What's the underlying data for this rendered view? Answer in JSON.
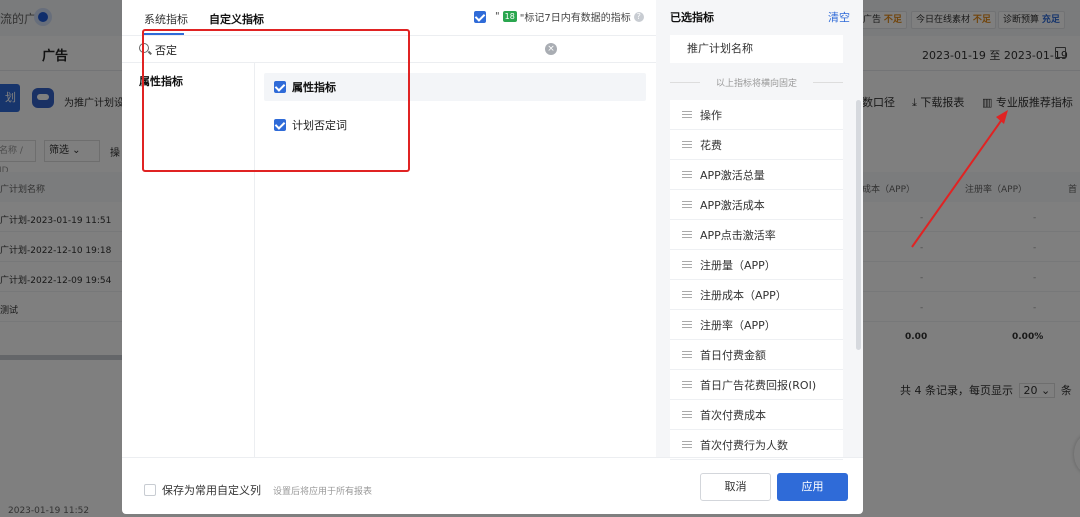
{
  "background": {
    "brand": "流的广告",
    "tab": "广告",
    "robot_text": "为推广计划设置",
    "blue_btn": "划",
    "name_placeholder": "名称 / ID",
    "filter_label": "筛选",
    "filter_tail": "操",
    "col_name": "广计划名称",
    "col_cost": "成本（APP）",
    "col_reg_rate": "注册率（APP）",
    "col_first": "首",
    "rows": [
      "广计划-2023-01-19 11:51",
      "广计划-2022-12-10 19:18",
      "广计划-2022-12-09 19:54",
      "测试"
    ],
    "dash": "-",
    "total_cost": "0.00",
    "total_rate": "0.00%",
    "badges": [
      {
        "label": "广告",
        "status": "不足",
        "kind": "warn"
      },
      {
        "label": "今日在线素材",
        "status": "不足",
        "kind": "warn"
      },
      {
        "label": "诊断预算",
        "status": "充足",
        "kind": "good"
      }
    ],
    "date_range": "2023-01-19 至 2023-01-19",
    "links": [
      "数口径",
      "下载报表",
      "专业版推荐指标"
    ],
    "pager_text": "共 4 条记录，每页显示",
    "page_size": "20",
    "pager_unit": "条",
    "footer_ts": "2023-01-19 11:52"
  },
  "modal": {
    "tabs": [
      "系统指标",
      "自定义指标"
    ],
    "mark7_label_prefix": "\"",
    "mark7_chip": "18",
    "mark7_label": "\"标记7日内有数据的指标",
    "search_value": "否定",
    "left_category": "属性指标",
    "group_label": "属性指标",
    "item_label": "计划否定词"
  },
  "selected": {
    "title": "已选指标",
    "clear": "清空",
    "fixed_item": "推广计划名称",
    "fixed_note": "以上指标将横向固定",
    "items": [
      "操作",
      "花费",
      "APP激活总量",
      "APP激活成本",
      "APP点击激活率",
      "注册量（APP）",
      "注册成本（APP）",
      "注册率（APP）",
      "首日付费金额",
      "首日广告花费回报(ROI)",
      "首次付费成本",
      "首次付费行为人数"
    ]
  },
  "footer": {
    "save_label": "保存为常用自定义列",
    "save_hint": "设置后将应用于所有报表",
    "cancel": "取消",
    "apply": "应用"
  },
  "colors": {
    "accent": "#2f6bd8",
    "annotation": "#e02323"
  }
}
